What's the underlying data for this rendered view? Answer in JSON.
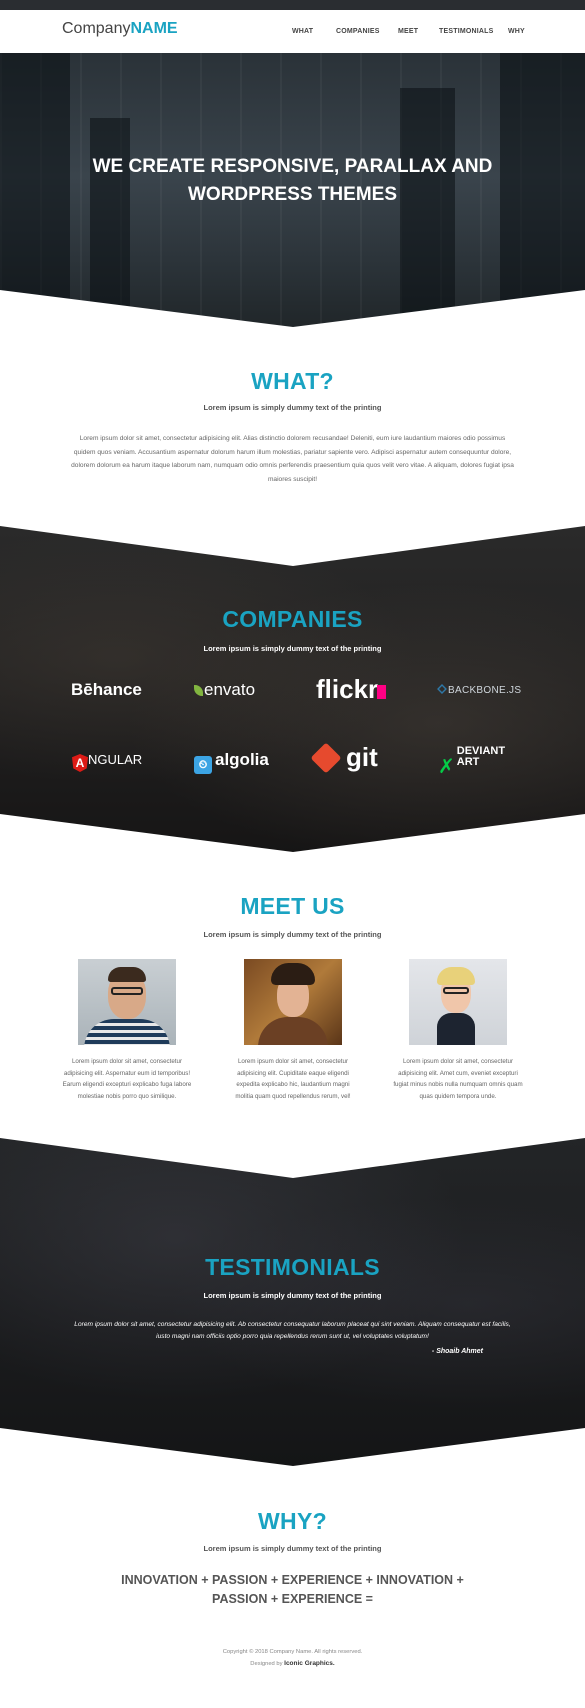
{
  "brand": {
    "prefix": "Company",
    "name": "NAME"
  },
  "nav": [
    "WHAT",
    "COMPANIES",
    "MEET",
    "TESTIMONIALS",
    "WHY"
  ],
  "hero": {
    "line1": "WE CREATE RESPONSIVE, PARALLAX AND",
    "line2": "WORDPRESS THEMES"
  },
  "what": {
    "title": "WHAT?",
    "subtitle": "Lorem ipsum is simply dummy text of the printing",
    "lines": [
      "Lorem ipsum dolor sit amet, consectetur adipisicing elit. Alias distinctio dolorem recusandae! Deleniti, eum iure laudantium maiores odio possimus",
      "quidem quos veniam. Accusantium aspernatur dolorum harum illum molestias, pariatur sapiente vero. Adipisci aspernatur autem consequuntur dolore,",
      "dolorem dolorum ea harum itaque laborum nam, numquam odio omnis perferendis praesentium quia quos velit vero vitae. A aliquam, dolores fugiat ipsa",
      "maiores suscipit!"
    ]
  },
  "companies": {
    "title": "COMPANIES",
    "subtitle": "Lorem ipsum is simply dummy text of the printing",
    "logos": [
      "Bēhance",
      "envato",
      "flickr",
      "BACKBONE.JS",
      "NGULAR",
      "algolia",
      "git",
      "DEVIANT ART"
    ]
  },
  "meet": {
    "title": "MEET US",
    "subtitle": "Lorem ipsum is simply dummy text of the printing",
    "members": [
      {
        "bio": [
          "Lorem ipsum dolor sit amet, consectetur",
          "adipisicing elit. Aspernatur eum id temporibus!",
          "Earum eligendi excepturi explicabo fuga labore",
          "molestiae nobis porro quo similique."
        ]
      },
      {
        "bio": [
          "Lorem ipsum dolor sit amet, consectetur",
          "adipisicing elit. Cupiditate eaque eligendi",
          "expedita explicabo hic, laudantium magni",
          "molitia quam quod repellendus rerum, vel!"
        ]
      },
      {
        "bio": [
          "Lorem ipsum dolor sit amet, consectetur",
          "adipisicing elit. Amet cum, eveniet excepturi",
          "fugiat minus nobis nulla numquam omnis quam",
          "quas quidem tempora unde."
        ]
      }
    ]
  },
  "testimonials": {
    "title": "TESTIMONIALS",
    "subtitle": "Lorem ipsum is simply dummy text of the printing",
    "quote_line1": "Lorem ipsum dolor sit amet, consectetur adipisicing elit. Ab consectetur consequatur laborum placeat qui sint veniam. Aliquam consequatur est facilis,",
    "quote_line2": "iusto magni nam officiis optio porro quia repellendus rerum sunt ut, vel voluptates voluptatum!",
    "author": "- Shoaib Ahmet"
  },
  "why": {
    "title": "WHY?",
    "subtitle": "Lorem ipsum is simply dummy text of the printing",
    "formula_line1": "INNOVATION + PASSION + EXPERIENCE + INNOVATION +",
    "formula_line2": "PASSION + EXPERIENCE ="
  },
  "footer": {
    "copyright": "Copyright © 2018 Company Name. All rights reserved.",
    "designed_prefix": "Designed by",
    "designed_by": "Iconic Graphics."
  },
  "colors": {
    "accent": "#1aa3c2",
    "dark": "#1d1c1c",
    "text": "#555555"
  }
}
